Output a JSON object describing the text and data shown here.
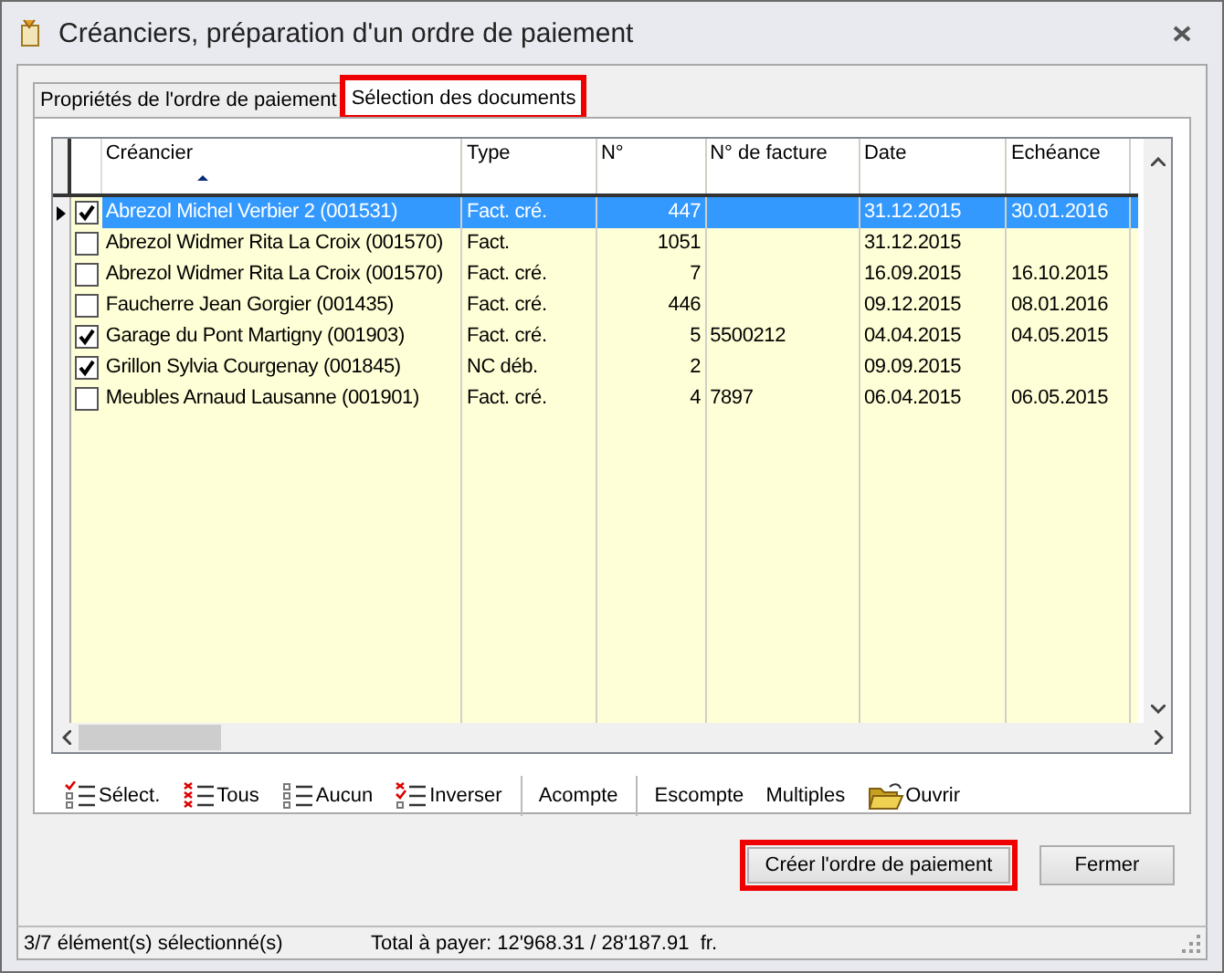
{
  "window": {
    "title": "Créanciers, préparation d'un ordre de paiement"
  },
  "tabs": [
    {
      "label": "Propriétés de l'ordre de paiement",
      "selected": false,
      "highlighted": false
    },
    {
      "label": "Sélection des documents",
      "selected": true,
      "highlighted": true
    }
  ],
  "table": {
    "columns": [
      {
        "label": "Créancier",
        "sorted": true
      },
      {
        "label": "Type",
        "sorted": false
      },
      {
        "label": "N°",
        "sorted": false
      },
      {
        "label": "N° de facture",
        "sorted": false
      },
      {
        "label": "Date",
        "sorted": false
      },
      {
        "label": "Echéance",
        "sorted": false
      }
    ],
    "rows": [
      {
        "checked": true,
        "selected": true,
        "cells": [
          "Abrezol Michel Verbier 2 (001531)",
          "Fact. cré.",
          "447",
          "",
          "31.12.2015",
          "30.01.2016"
        ]
      },
      {
        "checked": false,
        "selected": false,
        "cells": [
          "Abrezol Widmer Rita La Croix (001570)",
          "Fact.",
          "1051",
          "",
          "31.12.2015",
          ""
        ]
      },
      {
        "checked": false,
        "selected": false,
        "cells": [
          "Abrezol Widmer Rita La Croix (001570)",
          "Fact. cré.",
          "7",
          "",
          "16.09.2015",
          "16.10.2015"
        ]
      },
      {
        "checked": false,
        "selected": false,
        "cells": [
          "Faucherre Jean Gorgier (001435)",
          "Fact. cré.",
          "446",
          "",
          "09.12.2015",
          "08.01.2016"
        ]
      },
      {
        "checked": true,
        "selected": false,
        "cells": [
          "Garage du Pont Martigny (001903)",
          "Fact. cré.",
          "5",
          "5500212",
          "04.04.2015",
          "04.05.2015"
        ]
      },
      {
        "checked": true,
        "selected": false,
        "cells": [
          "Grillon Sylvia Courgenay (001845)",
          "NC déb.",
          "2",
          "",
          "09.09.2015",
          ""
        ]
      },
      {
        "checked": false,
        "selected": false,
        "cells": [
          "Meubles Arnaud Lausanne (001901)",
          "Fact. cré.",
          "4",
          "7897",
          "06.04.2015",
          "06.05.2015"
        ]
      }
    ]
  },
  "toolbar": [
    {
      "kind": "select",
      "label": "Sélect."
    },
    {
      "kind": "all",
      "label": "Tous"
    },
    {
      "kind": "none",
      "label": "Aucun"
    },
    {
      "kind": "invert",
      "label": "Inverser"
    },
    {
      "kind": "separator"
    },
    {
      "kind": "text",
      "label": "Acompte"
    },
    {
      "kind": "separator"
    },
    {
      "kind": "text",
      "label": "Escompte"
    },
    {
      "kind": "text",
      "label": "Multiples"
    },
    {
      "kind": "folder",
      "label": "Ouvrir"
    }
  ],
  "buttons": [
    {
      "label": "Créer l'ordre de paiement",
      "highlighted": true
    },
    {
      "label": "Fermer",
      "highlighted": false
    }
  ],
  "status_bar": {
    "selection": "3/7 élément(s) sélectionné(s)",
    "total": "Total à payer: 12'968.31 / 28'187.91  fr."
  }
}
